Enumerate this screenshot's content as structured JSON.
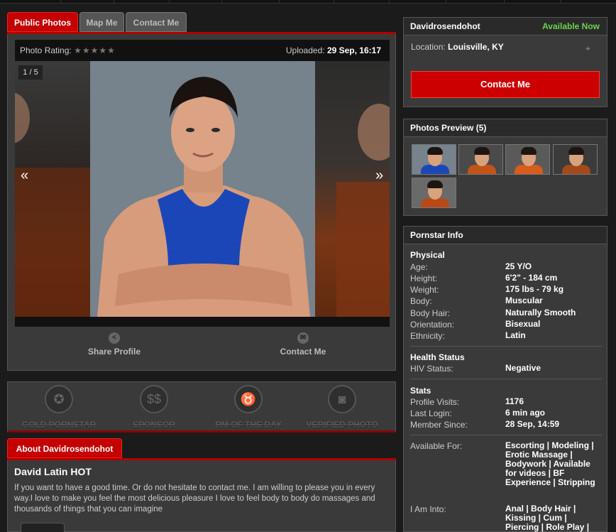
{
  "tabs": {
    "public_photos": "Public Photos",
    "map_me": "Map Me",
    "contact_me": "Contact Me"
  },
  "gallery": {
    "rating_label": "Photo Rating:",
    "stars": "★★★★★",
    "uploaded_label": "Uploaded:",
    "uploaded_value": "29 Sep, 16:17",
    "counter": "1 / 5",
    "prev": "«",
    "next": "»",
    "share_label": "Share Profile",
    "contact_label": "Contact Me"
  },
  "badges": [
    {
      "label": "GOLD PORNSTAR",
      "icon": "medal-icon"
    },
    {
      "label": "SPONSOR",
      "icon": "dollar-icon"
    },
    {
      "label": "RM OF THE DAY",
      "icon": "horns-icon"
    },
    {
      "label": "VERIFIED PHOTO",
      "icon": "camera-icon"
    }
  ],
  "about": {
    "tab_label": "About Davidrosendohot",
    "title": "David Latin HOT",
    "text": "If you want to have a good time. Or do not hesitate to contact me. I am willing to please you in every way.I love to make you feel the most delicious pleasure I love to feel body to body do massages and thousands of things that you can imagine"
  },
  "profile": {
    "username": "Davidrosendohot",
    "status": "Available Now",
    "location_label": "Location:",
    "location_value": "Louisville, KY",
    "contact_button": "Contact Me"
  },
  "preview": {
    "title": "Photos Preview (5)"
  },
  "info": {
    "title": "Pornstar Info",
    "physical_title": "Physical",
    "physical": [
      {
        "label": "Age:",
        "value": "25 Y/O"
      },
      {
        "label": "Height:",
        "value": "6'2\" - 184 cm"
      },
      {
        "label": "Weight:",
        "value": "175 lbs - 79 kg"
      },
      {
        "label": "Body:",
        "value": "Muscular"
      },
      {
        "label": "Body Hair:",
        "value": "Naturally Smooth"
      },
      {
        "label": "Orientation:",
        "value": "Bisexual"
      },
      {
        "label": "Ethnicity:",
        "value": "Latin"
      }
    ],
    "health_title": "Health Status",
    "health": [
      {
        "label": "HIV Status:",
        "value": "Negative"
      }
    ],
    "stats_title": "Stats",
    "stats": [
      {
        "label": "Profile Visits:",
        "value": "1176"
      },
      {
        "label": "Last Login:",
        "value": "6 min ago"
      },
      {
        "label": "Member Since:",
        "value": "28 Sep, 14:59"
      }
    ],
    "available_for_label": "Available For:",
    "available_for_value": "Escorting | Modeling | Erotic Massage | Bodywork | Available for videos | BF Experience | Stripping",
    "into_label": "I Am Into:",
    "into_value": "Anal | Body Hair | Kissing | Cum | Piercing | Role Play |"
  },
  "colors": {
    "accent": "#c40000",
    "available": "#6dd34a",
    "panel": "#3a3a3a",
    "background": "#1b1b1b"
  }
}
